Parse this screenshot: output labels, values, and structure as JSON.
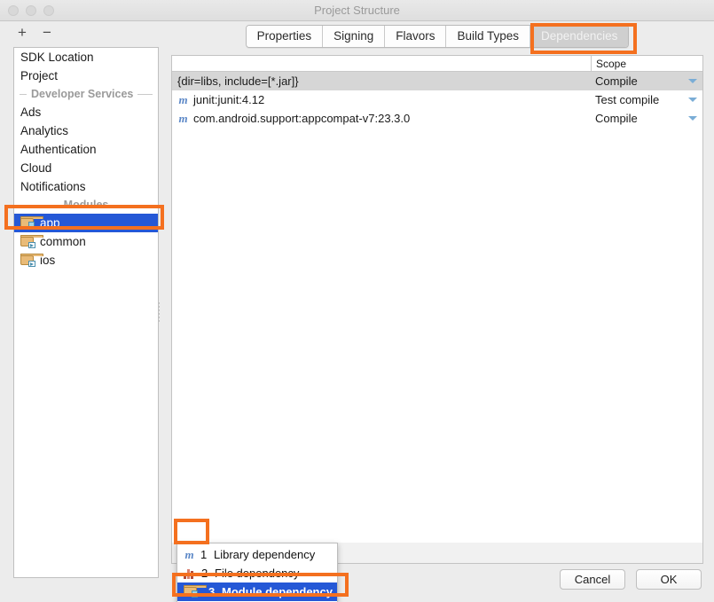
{
  "window": {
    "title": "Project Structure",
    "traffic_lights": [
      "close-button",
      "minimize-button",
      "zoom-button"
    ]
  },
  "left_toolbar": {
    "add_label": "+",
    "remove_label": "−"
  },
  "sidebar": {
    "items": [
      {
        "label": "SDK Location",
        "type": "item",
        "selected": false
      },
      {
        "label": "Project",
        "type": "item",
        "selected": false
      },
      {
        "label": "Developer Services",
        "type": "group"
      },
      {
        "label": "Ads",
        "type": "item",
        "selected": false
      },
      {
        "label": "Analytics",
        "type": "item",
        "selected": false
      },
      {
        "label": "Authentication",
        "type": "item",
        "selected": false
      },
      {
        "label": "Cloud",
        "type": "item",
        "selected": false
      },
      {
        "label": "Notifications",
        "type": "item",
        "selected": false
      },
      {
        "label": "Modules",
        "type": "group"
      },
      {
        "label": "app",
        "type": "module",
        "selected": true
      },
      {
        "label": "common",
        "type": "module",
        "selected": false
      },
      {
        "label": "ios",
        "type": "module",
        "selected": false
      }
    ]
  },
  "tabs": {
    "items": [
      "Properties",
      "Signing",
      "Flavors",
      "Build Types",
      "Dependencies"
    ],
    "active": "Dependencies"
  },
  "table": {
    "columns": [
      "",
      "Scope"
    ],
    "rows": [
      {
        "icon": "",
        "name": "{dir=libs, include=[*.jar]}",
        "scope": "Compile",
        "highlighted": true
      },
      {
        "icon": "maven-icon",
        "name": "junit:junit:4.12",
        "scope": "Test compile",
        "highlighted": false
      },
      {
        "icon": "maven-icon",
        "name": "com.android.support:appcompat-v7:23.3.0",
        "scope": "Compile",
        "highlighted": false
      }
    ]
  },
  "mini_toolbar": {
    "add": "+",
    "remove": "−",
    "move_up": "move-up-icon",
    "move_down": "move-down-icon"
  },
  "popup_menu": {
    "items": [
      {
        "num": "1",
        "label": "Library dependency",
        "icon": "maven-icon",
        "selected": false
      },
      {
        "num": "2",
        "label": "File dependency",
        "icon": "file-icon",
        "selected": false
      },
      {
        "num": "3",
        "label": "Module dependency",
        "icon": "module-icon",
        "selected": true
      }
    ]
  },
  "dialog_buttons": {
    "cancel": "Cancel",
    "ok": "OK"
  },
  "annotations": {
    "color": "#f4701f",
    "boxes": [
      "dependencies-tab-highlight",
      "app-module-highlight",
      "add-dependency-button-highlight",
      "module-dependency-menu-item-highlight"
    ]
  }
}
